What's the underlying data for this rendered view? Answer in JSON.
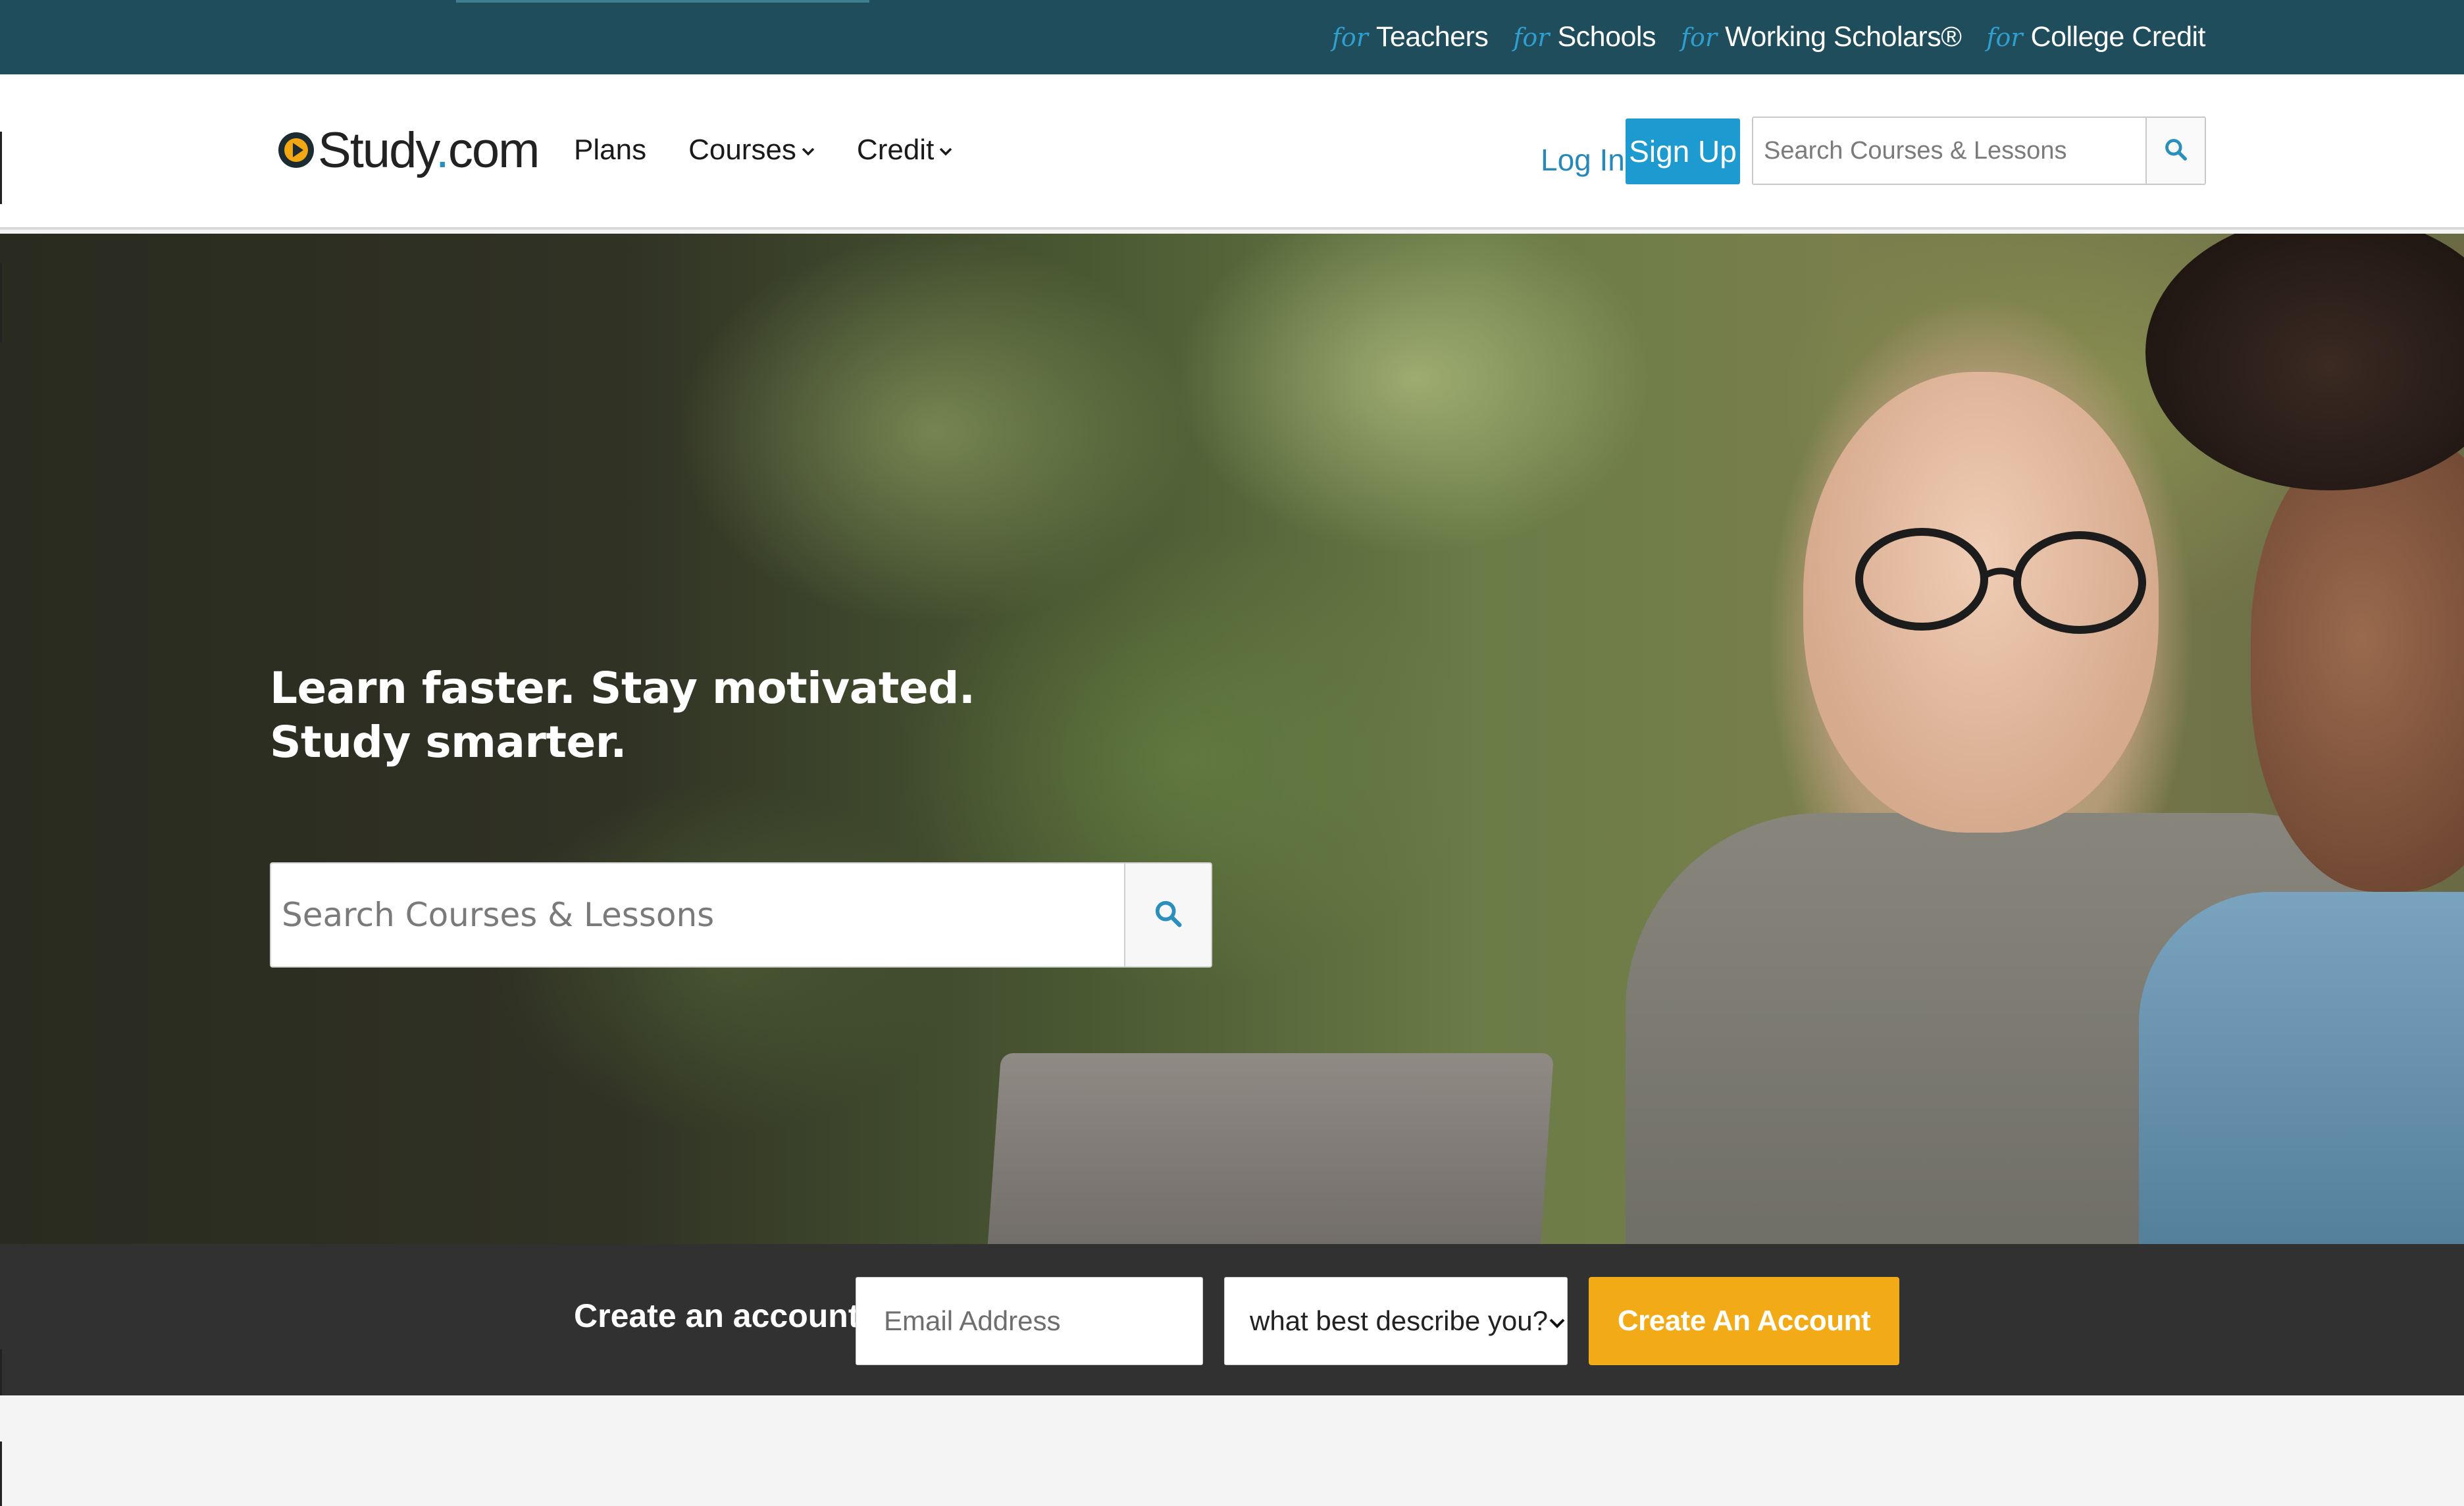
{
  "topbar": {
    "links": [
      {
        "prefix": "for",
        "label": "Teachers"
      },
      {
        "prefix": "for",
        "label": "Schools"
      },
      {
        "prefix": "for",
        "label": "Working Scholars®"
      },
      {
        "prefix": "for",
        "label": "College Credit"
      }
    ]
  },
  "header": {
    "logo": {
      "main": "Study",
      "dot": ".",
      "tld": "com"
    },
    "nav": [
      {
        "label": "Plans"
      },
      {
        "label": "Courses",
        "icon": "chevron-down-icon"
      },
      {
        "label": "Credit",
        "icon": "chevron-down-icon"
      }
    ],
    "login_label": "Log In",
    "signup_label": "Sign Up",
    "search_placeholder": "Search Courses & Lessons"
  },
  "hero": {
    "title_line1": "Learn faster. Stay motivated.",
    "title_line2": "Study smarter.",
    "search_placeholder": "Search Courses & Lessons"
  },
  "cta": {
    "label": "Create an account",
    "email_placeholder": "Email Address",
    "select_value": "what best describe you?",
    "button_label": "Create An Account"
  },
  "colors": {
    "topbar": "#1f4d5b",
    "accent_blue": "#1d9bd1",
    "cta_bar": "#313131",
    "cta_button": "#f2ab17"
  }
}
